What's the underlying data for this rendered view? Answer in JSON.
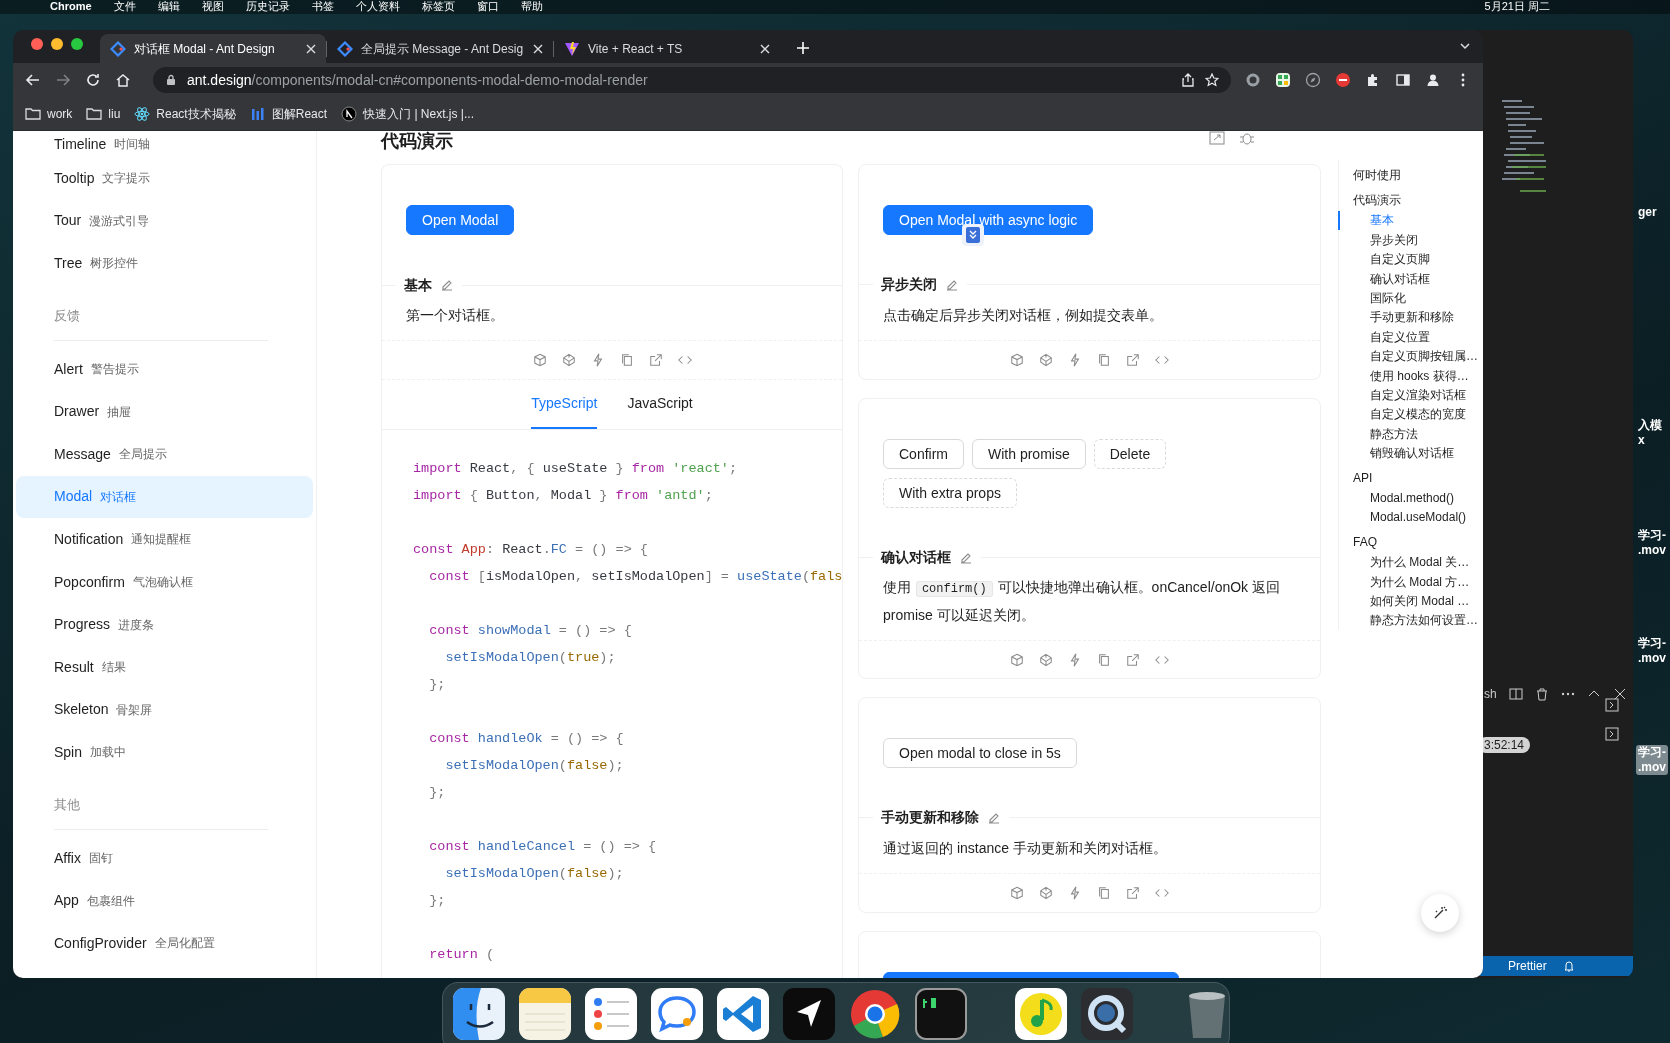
{
  "menubar": {
    "app": "Chrome",
    "menus": [
      "文件",
      "编辑",
      "视图",
      "历史记录",
      "书签",
      "个人资料",
      "标签页",
      "窗口",
      "帮助"
    ],
    "clock": "5月21日 周二"
  },
  "browser": {
    "tabs": [
      {
        "title": "对话框 Modal - Ant Design",
        "selected": true
      },
      {
        "title": "全局提示 Message - Ant Desig",
        "selected": false
      },
      {
        "title": "Vite + React + TS",
        "selected": false
      }
    ],
    "url": {
      "host": "ant.design",
      "path": "/components/modal-cn#components-modal-demo-modal-render"
    },
    "bookmarks": [
      {
        "label": "work"
      },
      {
        "label": "liu"
      },
      {
        "label": "React技术揭秘"
      },
      {
        "label": "图解React"
      },
      {
        "label": "快速入门 | Next.js |..."
      }
    ]
  },
  "sidebar": {
    "items": [
      {
        "kind": "item",
        "name": "Timeline",
        "cn": "时间轴",
        "selected": false
      },
      {
        "kind": "item",
        "name": "Tooltip",
        "cn": "文字提示",
        "selected": false
      },
      {
        "kind": "item",
        "name": "Tour",
        "cn": "漫游式引导",
        "selected": false
      },
      {
        "kind": "item",
        "name": "Tree",
        "cn": "树形控件",
        "selected": false
      },
      {
        "kind": "group",
        "label": "反馈"
      },
      {
        "kind": "item",
        "name": "Alert",
        "cn": "警告提示",
        "selected": false
      },
      {
        "kind": "item",
        "name": "Drawer",
        "cn": "抽屉",
        "selected": false
      },
      {
        "kind": "item",
        "name": "Message",
        "cn": "全局提示",
        "selected": false
      },
      {
        "kind": "item",
        "name": "Modal",
        "cn": "对话框",
        "selected": true
      },
      {
        "kind": "item",
        "name": "Notification",
        "cn": "通知提醒框",
        "selected": false
      },
      {
        "kind": "item",
        "name": "Popconfirm",
        "cn": "气泡确认框",
        "selected": false
      },
      {
        "kind": "item",
        "name": "Progress",
        "cn": "进度条",
        "selected": false
      },
      {
        "kind": "item",
        "name": "Result",
        "cn": "结果",
        "selected": false
      },
      {
        "kind": "item",
        "name": "Skeleton",
        "cn": "骨架屏",
        "selected": false
      },
      {
        "kind": "item",
        "name": "Spin",
        "cn": "加载中",
        "selected": false
      },
      {
        "kind": "group",
        "label": "其他"
      },
      {
        "kind": "item",
        "name": "Affix",
        "cn": "固钉",
        "selected": false
      },
      {
        "kind": "item",
        "name": "App",
        "cn": "包裹组件",
        "selected": false
      },
      {
        "kind": "item",
        "name": "ConfigProvider",
        "cn": "全局化配置",
        "selected": false
      }
    ]
  },
  "heading": "代码演示",
  "left_demo": {
    "buttons": [
      {
        "label": "Open Modal",
        "kind": "primary"
      }
    ],
    "title": "基本",
    "description": [
      {
        "kind": "text",
        "text": "第一个对话框。"
      }
    ],
    "code_tabs": [
      {
        "label": "TypeScript",
        "selected": true
      },
      {
        "label": "JavaScript",
        "selected": false
      }
    ],
    "code": [
      {
        "tokens": [
          {
            "kind": "kw",
            "text": "import"
          },
          {
            "kind": "id",
            "text": " React"
          },
          {
            "kind": "op",
            "text": ", { "
          },
          {
            "kind": "id",
            "text": "useState"
          },
          {
            "kind": "op",
            "text": " } "
          },
          {
            "kind": "kw",
            "text": "from"
          },
          {
            "kind": "str",
            "text": " 'react'"
          },
          {
            "kind": "op",
            "text": ";"
          }
        ]
      },
      {
        "tokens": [
          {
            "kind": "kw",
            "text": "import"
          },
          {
            "kind": "op",
            "text": " { "
          },
          {
            "kind": "id",
            "text": "Button"
          },
          {
            "kind": "op",
            "text": ", "
          },
          {
            "kind": "id",
            "text": "Modal"
          },
          {
            "kind": "op",
            "text": " } "
          },
          {
            "kind": "kw",
            "text": "from"
          },
          {
            "kind": "str",
            "text": " 'antd'"
          },
          {
            "kind": "op",
            "text": ";"
          }
        ]
      },
      {
        "gap": true,
        "tokens": [
          {
            "kind": "kw",
            "text": "const"
          },
          {
            "kind": "cls",
            "text": " App"
          },
          {
            "kind": "op",
            "text": ": "
          },
          {
            "kind": "id",
            "text": "React"
          },
          {
            "kind": "op",
            "text": "."
          },
          {
            "kind": "fn",
            "text": "FC"
          },
          {
            "kind": "op",
            "text": " = () => {"
          }
        ]
      },
      {
        "tokens": [
          {
            "kind": "kw",
            "text": "  const"
          },
          {
            "kind": "op",
            "text": " ["
          },
          {
            "kind": "id",
            "text": "isModalOpen"
          },
          {
            "kind": "op",
            "text": ", "
          },
          {
            "kind": "id",
            "text": "setIsModalOpen"
          },
          {
            "kind": "op",
            "text": "] = "
          },
          {
            "kind": "fn",
            "text": "useState"
          },
          {
            "kind": "op",
            "text": "("
          },
          {
            "kind": "bool",
            "text": "fals"
          }
        ]
      },
      {
        "gap": true,
        "tokens": [
          {
            "kind": "kw",
            "text": "  const"
          },
          {
            "kind": "fn",
            "text": " showModal"
          },
          {
            "kind": "op",
            "text": " = () => {"
          }
        ]
      },
      {
        "tokens": [
          {
            "kind": "fn",
            "text": "    setIsModalOpen"
          },
          {
            "kind": "op",
            "text": "("
          },
          {
            "kind": "bool",
            "text": "true"
          },
          {
            "kind": "op",
            "text": ");"
          }
        ]
      },
      {
        "tokens": [
          {
            "kind": "op",
            "text": "  };"
          }
        ]
      },
      {
        "gap": true,
        "tokens": [
          {
            "kind": "kw",
            "text": "  const"
          },
          {
            "kind": "fn",
            "text": " handleOk"
          },
          {
            "kind": "op",
            "text": " = () => {"
          }
        ]
      },
      {
        "tokens": [
          {
            "kind": "fn",
            "text": "    setIsModalOpen"
          },
          {
            "kind": "op",
            "text": "("
          },
          {
            "kind": "bool",
            "text": "false"
          },
          {
            "kind": "op",
            "text": ");"
          }
        ]
      },
      {
        "tokens": [
          {
            "kind": "op",
            "text": "  };"
          }
        ]
      },
      {
        "gap": true,
        "tokens": [
          {
            "kind": "kw",
            "text": "  const"
          },
          {
            "kind": "fn",
            "text": " handleCancel"
          },
          {
            "kind": "op",
            "text": " = () => {"
          }
        ]
      },
      {
        "tokens": [
          {
            "kind": "fn",
            "text": "    setIsModalOpen"
          },
          {
            "kind": "op",
            "text": "("
          },
          {
            "kind": "bool",
            "text": "false"
          },
          {
            "kind": "op",
            "text": ");"
          }
        ]
      },
      {
        "tokens": [
          {
            "kind": "op",
            "text": "  };"
          }
        ]
      },
      {
        "gap": true,
        "tokens": [
          {
            "kind": "kw",
            "text": "  return"
          },
          {
            "kind": "op",
            "text": " ("
          }
        ]
      }
    ]
  },
  "right_demos": [
    {
      "buttons": [
        {
          "label": "Open Modal with async logic",
          "kind": "primary"
        }
      ],
      "title": "异步关闭",
      "description": [
        {
          "kind": "text",
          "text": "点击确定后异步关闭对话框，例如提交表单。"
        }
      ]
    },
    {
      "buttons": [
        {
          "label": "Confirm",
          "kind": "default"
        },
        {
          "label": "With promise",
          "kind": "default"
        },
        {
          "label": "Delete",
          "kind": "dashed"
        },
        {
          "label": "With extra props",
          "kind": "dashed"
        }
      ],
      "title": "确认对话框",
      "description": [
        {
          "kind": "text",
          "text": "使用 "
        },
        {
          "kind": "code",
          "text": "confirm()"
        },
        {
          "kind": "text",
          "text": " 可以快捷地弹出确认框。onCancel/onOk 返回 promise 可以延迟关闭。"
        }
      ]
    },
    {
      "buttons": [
        {
          "label": "Open modal to close in 5s",
          "kind": "default"
        }
      ],
      "title": "手动更新和移除",
      "description": [
        {
          "kind": "text",
          "text": "通过返回的 instance 手动更新和关闭对话框。"
        }
      ]
    },
    {
      "buttons": [
        {
          "kind": "primary"
        }
      ]
    }
  ],
  "toc": [
    {
      "label": "何时使用",
      "selected": false
    },
    {
      "label": "代码演示",
      "selected": false,
      "children": [
        {
          "label": "基本",
          "selected": true
        },
        {
          "label": "异步关闭",
          "selected": false
        },
        {
          "label": "自定义页脚",
          "selected": false
        },
        {
          "label": "确认对话框",
          "selected": false
        },
        {
          "label": "国际化",
          "selected": false
        },
        {
          "label": "手动更新和移除",
          "selected": false
        },
        {
          "label": "自定义位置",
          "selected": false
        },
        {
          "label": "自定义页脚按钮属…",
          "selected": false
        },
        {
          "label": "使用 hooks 获得…",
          "selected": false
        },
        {
          "label": "自定义渲染对话框",
          "selected": false
        },
        {
          "label": "自定义模态的宽度",
          "selected": false
        },
        {
          "label": "静态方法",
          "selected": false
        },
        {
          "label": "销毁确认对话框",
          "selected": false
        }
      ]
    },
    {
      "label": "API",
      "selected": false,
      "children": [
        {
          "label": "Modal.method()",
          "selected": false
        },
        {
          "label": "Modal.useModal()",
          "selected": false
        }
      ]
    },
    {
      "label": "FAQ",
      "selected": false,
      "children": [
        {
          "label": "为什么 Modal 关…",
          "selected": false
        },
        {
          "label": "为什么 Modal 方…",
          "selected": false
        },
        {
          "label": "如何关闭 Modal …",
          "selected": false
        },
        {
          "label": "静态方法如何设置…",
          "selected": false
        }
      ]
    }
  ],
  "editor": {
    "terminal_tab": "sh",
    "timestamp": "3:52:14",
    "status": "Prettier"
  },
  "desktop_files": [
    {
      "lines": [
        "ger"
      ],
      "selected": false
    },
    {
      "lines": [
        "入模",
        "x"
      ],
      "selected": false
    },
    {
      "lines": [
        "学习-",
        ".mov"
      ],
      "selected": false
    },
    {
      "lines": [
        "学习-",
        ".mov"
      ],
      "selected": false
    },
    {
      "lines": [
        "学习-",
        ".mov"
      ],
      "selected": true
    }
  ],
  "dock": [
    {
      "kind": "finder"
    },
    {
      "kind": "notes"
    },
    {
      "kind": "reminders"
    },
    {
      "kind": "chat"
    },
    {
      "kind": "vscode"
    },
    {
      "kind": "arrow"
    },
    {
      "kind": "chrome"
    },
    {
      "kind": "terminal"
    },
    {
      "kind": "separator"
    },
    {
      "kind": "music"
    },
    {
      "kind": "quicktime"
    },
    {
      "kind": "separator"
    },
    {
      "kind": "trash"
    }
  ]
}
